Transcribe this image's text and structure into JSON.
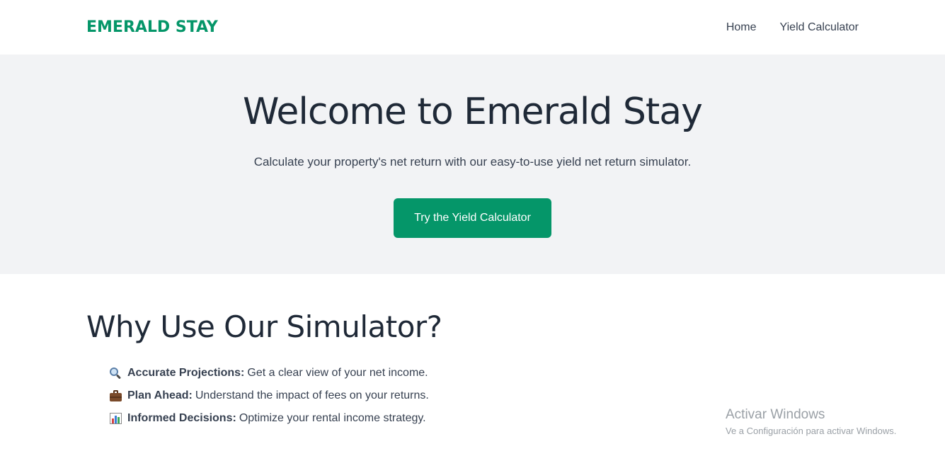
{
  "navbar": {
    "brand": "EMERALD STAY",
    "links": [
      {
        "label": "Home"
      },
      {
        "label": "Yield Calculator"
      }
    ]
  },
  "hero": {
    "title": "Welcome to Emerald Stay",
    "subtitle": "Calculate your property's net return with our easy-to-use yield net return simulator.",
    "cta_label": "Try the Yield Calculator"
  },
  "features": {
    "title": "Why Use Our Simulator?",
    "items": [
      {
        "icon": "magnifying-glass-icon",
        "label": "Accurate Projections:",
        "text": "Get a clear view of your net income."
      },
      {
        "icon": "briefcase-icon",
        "label": "Plan Ahead:",
        "text": "Understand the impact of fees on your returns."
      },
      {
        "icon": "bar-chart-icon",
        "label": "Informed Decisions:",
        "text": "Optimize your rental income strategy."
      }
    ]
  },
  "watermark": {
    "title": "Activar Windows",
    "subtitle": "Ve a Configuración para activar Windows."
  },
  "colors": {
    "brand": "#059669",
    "hero_background": "#f2f3f5",
    "text": "#1f2937"
  }
}
